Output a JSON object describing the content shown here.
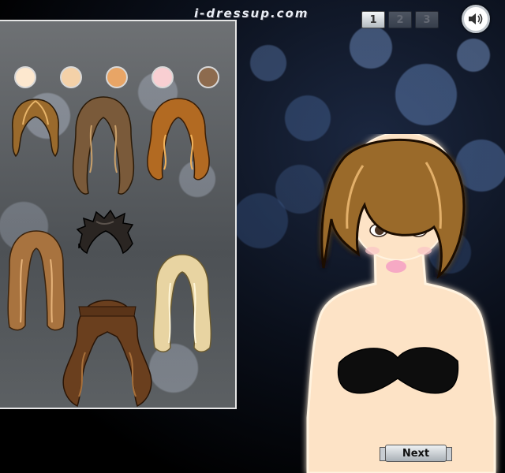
{
  "site": {
    "logo_text": "i-dressup.com"
  },
  "pagination": {
    "pages": [
      "1",
      "2",
      "3"
    ],
    "active": "1"
  },
  "sound": {
    "icon": "speaker-icon"
  },
  "skin_tones": [
    {
      "name": "skin-tone-1",
      "color": "#fde8cf"
    },
    {
      "name": "skin-tone-2",
      "color": "#f4d1a8"
    },
    {
      "name": "skin-tone-3",
      "color": "#e8a566"
    },
    {
      "name": "skin-tone-4",
      "color": "#f9cfd2"
    },
    {
      "name": "skin-tone-5",
      "color": "#8d6b4e"
    }
  ],
  "hairstyles": [
    {
      "name": "hairstyle-short-bob",
      "color": "#9a6a2c"
    },
    {
      "name": "hairstyle-long-wavy-ash",
      "color": "#7a5a3a"
    },
    {
      "name": "hairstyle-wavy-auburn",
      "color": "#b26a22"
    },
    {
      "name": "hairstyle-short-spiky-dark",
      "color": "#2a2522"
    },
    {
      "name": "hairstyle-long-straight-caramel",
      "color": "#a8733f"
    },
    {
      "name": "hairstyle-long-curly-brown",
      "color": "#6a3f1e"
    },
    {
      "name": "hairstyle-long-platinum",
      "color": "#e8d4a2"
    }
  ],
  "model": {
    "hair_color": "#9a6a2c",
    "skin_color": "#fde3c6",
    "top_color": "#111111"
  },
  "next_button": {
    "label": "Next"
  }
}
